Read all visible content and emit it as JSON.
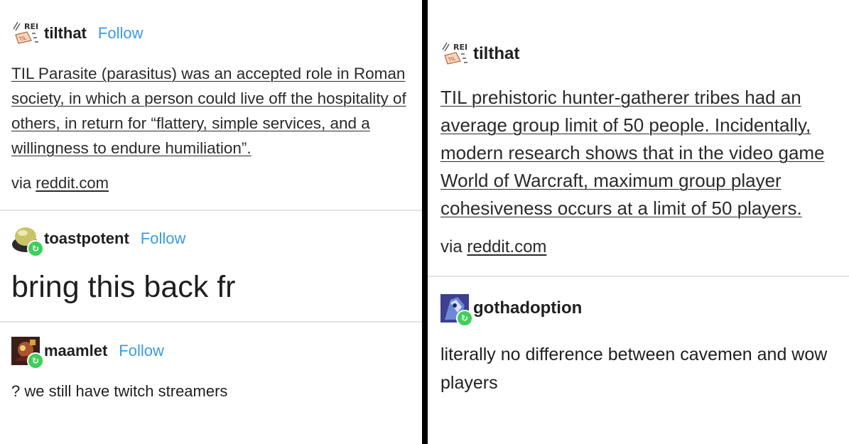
{
  "left": {
    "post": {
      "username": "tilthat",
      "follow_label": "Follow",
      "avatar_text": "REI",
      "body": "TIL Parasite (parasitus) was an accepted role in Roman society, in which a person could live off the hospitality of others, in return for “flattery, simple services, and a willingness to endure humiliation”.",
      "via_prefix": "via",
      "via_link": "reddit.com"
    },
    "reblog1": {
      "username": "toastpotent",
      "follow_label": "Follow",
      "text": "bring this back fr"
    },
    "reblog2": {
      "username": "maamlet",
      "follow_label": "Follow",
      "text": "? we still have twitch streamers"
    }
  },
  "right": {
    "post": {
      "username": "tilthat",
      "avatar_text": "REI",
      "body": "TIL prehistoric hunter-gatherer tribes had an average group limit of 50 people. Incidentally, modern research shows that in the video game World of Warcraft, maximum group player cohesiveness occurs at a limit of 50 players.",
      "via_prefix": "via",
      "via_link": "reddit.com"
    },
    "reblog": {
      "username": "gothadoption",
      "text": "literally no difference between cavemen and wow players"
    }
  },
  "colors": {
    "follow": "#3b9ae1",
    "reblog_badge": "#3ecf5a",
    "divider": "#000000"
  },
  "icons": {
    "reblog": "reblog-icon"
  }
}
